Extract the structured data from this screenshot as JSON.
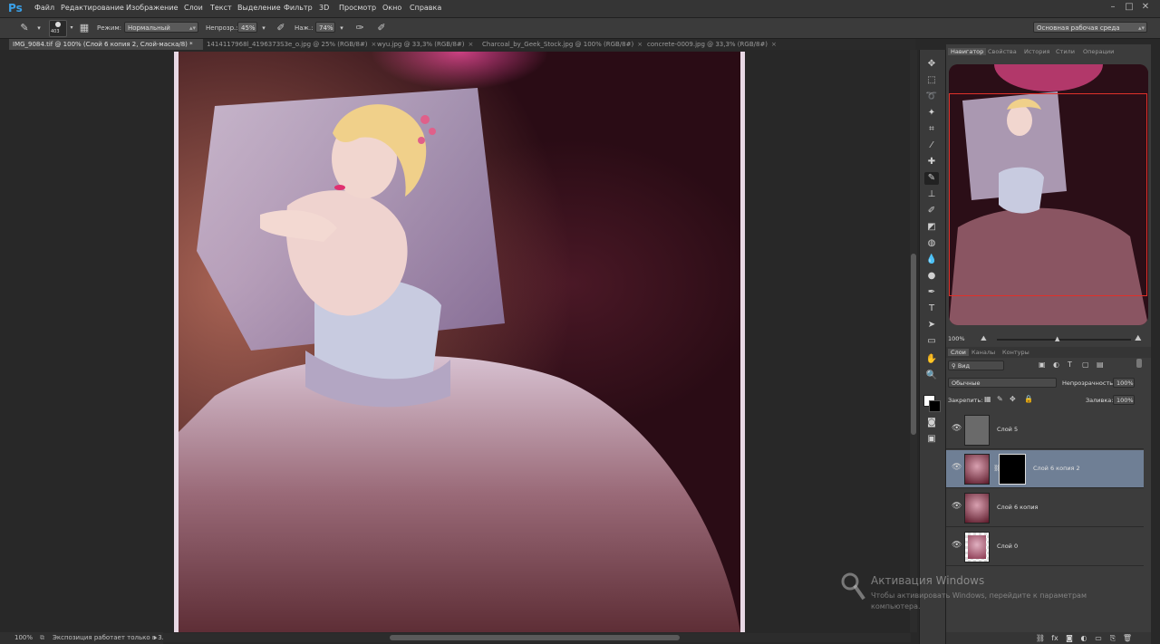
{
  "app": {
    "logo": "Ps"
  },
  "menu": [
    "Файл",
    "Редактирование",
    "Изображение",
    "Слои",
    "Текст",
    "Выделение",
    "Фильтр",
    "3D",
    "Просмотр",
    "Окно",
    "Справка"
  ],
  "options": {
    "brush_size": "403",
    "mode_label": "Режим:",
    "mode_value": "Нормальный",
    "opacity_label": "Непрозр.:",
    "opacity_value": "45%",
    "pressure_label": "Наж.:",
    "pressure_value": "74%",
    "workspace": "Основная рабочая среда"
  },
  "tabs": [
    {
      "label": "IMG_9084.tif @ 100% (Слой 6 копия 2, Слой-маска/8) *",
      "active": true
    },
    {
      "label": "1414117968l_4196373S3e_o.jpg @ 25% (RGB/8#)",
      "active": false
    },
    {
      "label": "wyu.jpg @ 33,3% (RGB/8#)",
      "active": false
    },
    {
      "label": "Charcoal_by_Geek_Stock.jpg @ 100% (RGB/8#)",
      "active": false
    },
    {
      "label": "concrete-0009.jpg @ 33,3% (RGB/8#)",
      "active": false
    }
  ],
  "status": {
    "zoom": "100%",
    "message": "Экспозиция работает только в 3..."
  },
  "panel_tabs_top": [
    "Навигатор",
    "Свойства",
    "История",
    "Стили",
    "Операции"
  ],
  "navigator": {
    "zoom": "100%"
  },
  "panel_tabs_layers": [
    "Слои",
    "Каналы",
    "Контуры"
  ],
  "layers_panel": {
    "filter": "Вид",
    "blend_mode": "Обычные",
    "opacity_label": "Непрозрачность:",
    "opacity_value": "100%",
    "lock_label": "Закрепить:",
    "fill_label": "Заливка:",
    "fill_value": "100%"
  },
  "layers": [
    {
      "name": "Слой 5",
      "selected": false
    },
    {
      "name": "Слой 6 копия 2",
      "selected": true
    },
    {
      "name": "Слой 6 копия",
      "selected": false
    },
    {
      "name": "Слой 0",
      "selected": false
    }
  ],
  "activation": {
    "title": "Активация Windows",
    "subtitle": "Чтобы активировать Windows, перейдите к параметрам компьютера."
  },
  "colors": {
    "accent_red": "#e0312a",
    "ps_blue": "#3aa0e8",
    "selected_layer": "#6f7f95"
  }
}
